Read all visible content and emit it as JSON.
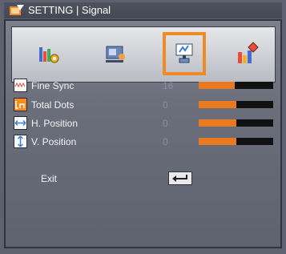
{
  "header": {
    "title": "SETTING | Signal"
  },
  "tabs": [
    {
      "name": "picture-settings-icon",
      "selected": false
    },
    {
      "name": "display-settings-icon",
      "selected": false
    },
    {
      "name": "setting-signal-icon",
      "selected": true
    },
    {
      "name": "options-icon",
      "selected": false
    }
  ],
  "items": [
    {
      "label": "Fine Sync",
      "value": "16",
      "fraction": 0.48,
      "icon": "fine-sync-icon"
    },
    {
      "label": "Total Dots",
      "value": "0",
      "fraction": 0.5,
      "icon": "total-dots-icon"
    },
    {
      "label": "H. Position",
      "value": "0",
      "fraction": 0.5,
      "icon": "h-position-icon"
    },
    {
      "label": "V. Position",
      "value": "0",
      "fraction": 0.5,
      "icon": "v-position-icon"
    }
  ],
  "exit": {
    "label": "Exit",
    "icon": "enter-return-icon"
  },
  "colors": {
    "accent": "#f08a24",
    "bar_fill": "#e97a1f",
    "bar_track": "#111111"
  }
}
